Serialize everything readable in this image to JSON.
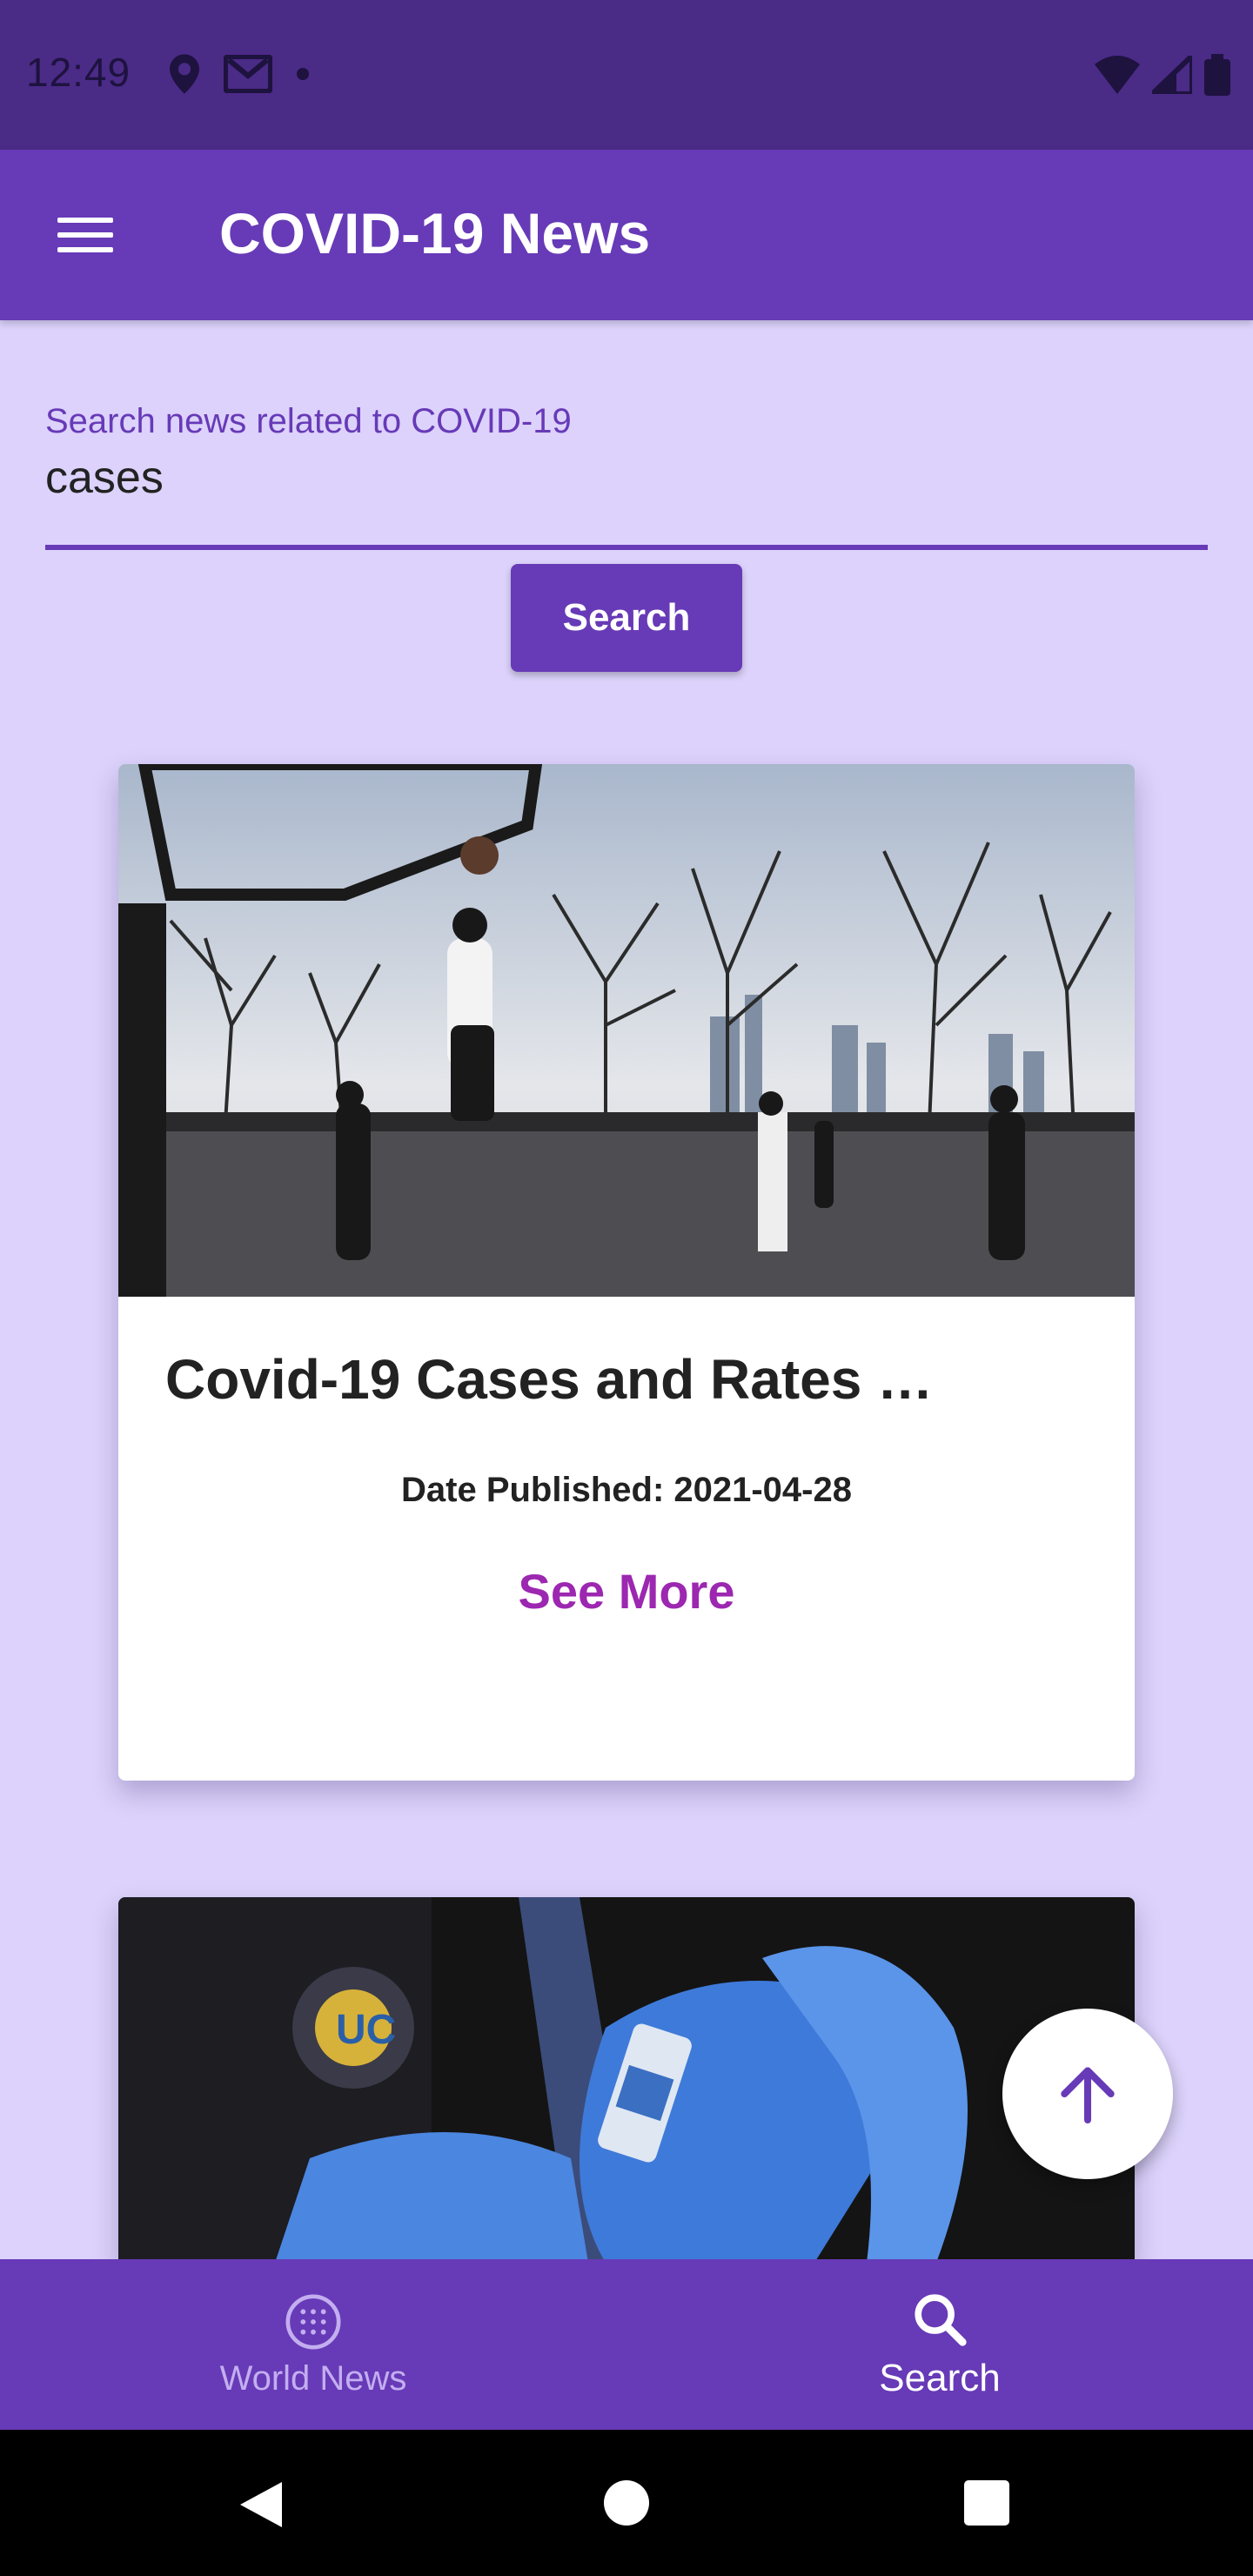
{
  "status_bar": {
    "time": "12:49",
    "left_icons": [
      "location-icon",
      "gmail-icon",
      "dot-icon"
    ],
    "right_icons": [
      "wifi-icon",
      "signal-icon",
      "battery-icon"
    ]
  },
  "app_bar": {
    "title": "COVID-19 News",
    "menu_icon": "hamburger-menu-icon"
  },
  "search": {
    "label": "Search news related to COVID-19",
    "value": "cases",
    "button_label": "Search"
  },
  "articles": [
    {
      "title": "Covid-19 Cases and Rates …",
      "date_label": "Date Published: 2021-04-28",
      "more_label": "See More",
      "image": "basketball-court-photo"
    },
    {
      "image": "vaccine-vial-photo"
    }
  ],
  "fab": {
    "icon": "arrow-up-icon"
  },
  "bottom_nav": {
    "items": [
      {
        "label": "World News",
        "icon": "globe-icon",
        "active": false
      },
      {
        "label": "Search",
        "icon": "search-icon",
        "active": true
      }
    ]
  },
  "colors": {
    "primary": "#673ab7",
    "status_bar": "#4a2b86",
    "background": "#dcd2fb",
    "see_more": "#9c27b0"
  }
}
